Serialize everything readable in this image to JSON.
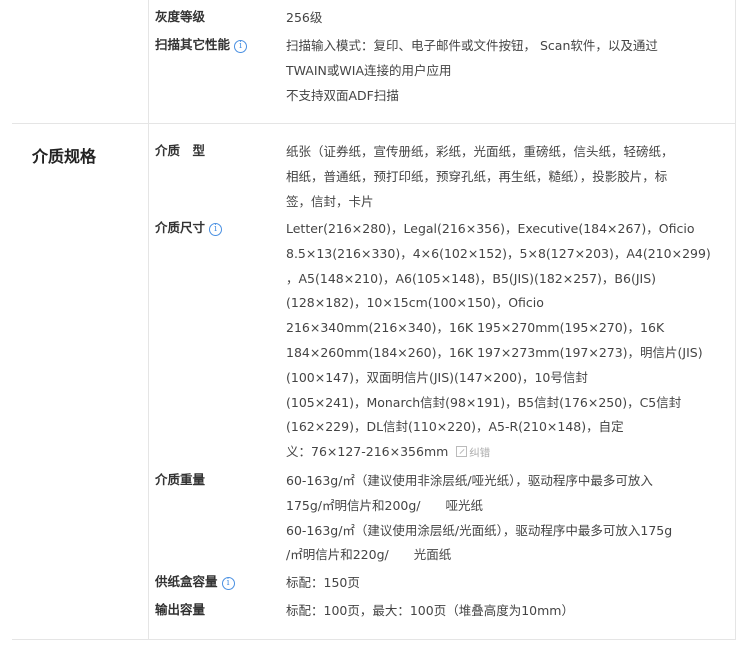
{
  "scan_section": {
    "rows": [
      {
        "key": "灰度等级",
        "has_info": false,
        "lines": [
          "256级"
        ]
      },
      {
        "key": "扫描其它性能",
        "has_info": true,
        "lines": [
          "扫描输入模式：复印、电子邮件或文件按钮，    Scan软件，以及通过",
          "TWAIN或WIA连接的用户应用",
          "不支持双面ADF扫描"
        ]
      }
    ]
  },
  "media_section": {
    "title": "介质规格",
    "rows": [
      {
        "key": "介质　型",
        "has_info": false,
        "lines": [
          "纸张（证券纸，宣传册纸，彩纸，光面纸，重磅纸，信头纸，轻磅纸，",
          "相纸，普通纸，预打印纸，预穿孔纸，再生纸，糙纸），投影胶片，标",
          "签，信封，卡片"
        ]
      },
      {
        "key": "介质尺寸",
        "has_info": true,
        "lines": [
          "Letter(216×280)，Legal(216×356)，Executive(184×267)，Oficio",
          "8.5×13(216×330)，4×6(102×152)，5×8(127×203)，A4(210×299)",
          "，A5(148×210)，A6(105×148)，B5(JIS)(182×257)，B6(JIS)",
          "(128×182)，10×15cm(100×150)，Oficio",
          "216×340mm(216×340)，16K 195×270mm(195×270)，16K",
          "184×260mm(184×260)，16K 197×273mm(197×273)，明信片(JIS)",
          "(100×147)，双面明信片(JIS)(147×200)，10号信封",
          "(105×241)，Monarch信封(98×191)，B5信封(176×250)，C5信封",
          "(162×229)，DL信封(110×220)，A5-R(210×148)，自定",
          "义：76×127-216×356mm"
        ],
        "error_link": "纠错"
      },
      {
        "key": "介质重量",
        "has_info": false,
        "lines": [
          "60-163g/㎡（建议使用非涂层纸/哑光纸），驱动程序中最多可放入",
          "175g/㎡明信片和200g/　　哑光纸",
          "60-163g/㎡（建议使用涂层纸/光面纸），驱动程序中最多可放入175g",
          "/㎡明信片和220g/　　光面纸"
        ]
      },
      {
        "key": "供纸盒容量",
        "has_info": true,
        "lines": [
          "标配：150页"
        ]
      },
      {
        "key": "输出容量",
        "has_info": false,
        "lines": [
          "标配：100页，最大：100页（堆叠高度为10mm）"
        ]
      }
    ]
  },
  "icons": {
    "info": "i"
  }
}
